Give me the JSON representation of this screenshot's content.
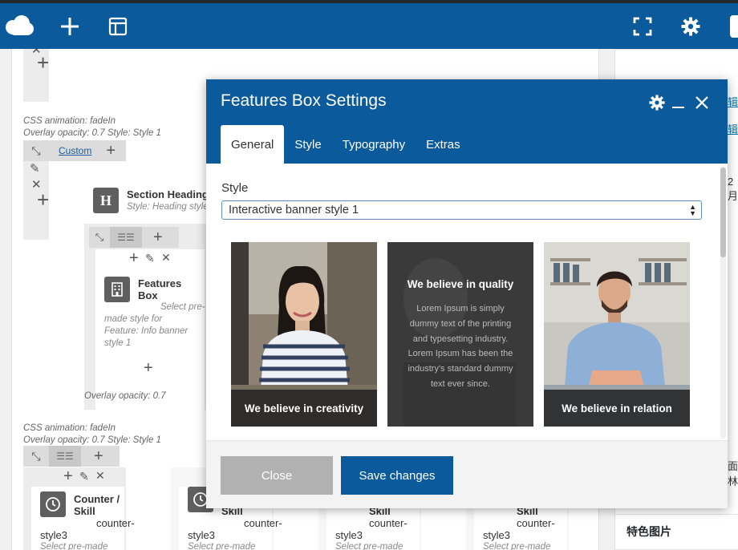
{
  "toolbar": {
    "icons": [
      "cloud-logo-icon",
      "plus-icon",
      "layout-icon",
      "fullscreen-icon",
      "gear-icon"
    ]
  },
  "builder": {
    "row1": {
      "meta_line1": "CSS animation: fadeIn",
      "meta_line2": "Overlay opacity: 0.7  Style: Style 1",
      "custom_link": "Custom"
    },
    "section_heading": {
      "title": "Section Heading",
      "subtitle": "Style: Heading style"
    },
    "features_box": {
      "title_line1": "Features",
      "title_line2": "Box",
      "desc": [
        "Select pre-",
        "made style for",
        "Feature: Info banner",
        "style 1"
      ]
    },
    "overlay_note": "Overlay opacity: 0.7",
    "row2": {
      "meta_line1": "CSS animation: fadeIn",
      "meta_line2": "Overlay opacity: 0.7  Style: Style 1"
    },
    "counters": [
      {
        "title1": "Counter /",
        "title2": "Skill",
        "sub": "counter-",
        "style": "style3",
        "desc": "Select pre-made"
      },
      {
        "title1": "",
        "title2": "Skill",
        "sub": "counter-",
        "style": "style3",
        "desc": "Select pre-made"
      },
      {
        "title1": "",
        "title2": "Skill",
        "sub": "counter-",
        "style": "style3",
        "desc": "Select pre-made"
      },
      {
        "title1": "",
        "title2": "Skill",
        "sub": "counter-",
        "style": "style3",
        "desc": "Select pre-made"
      }
    ]
  },
  "right_column": {
    "link1": "辑",
    "link2": "辑",
    "text1": "2月",
    "text2": "面林",
    "featured_image": "特色图片"
  },
  "modal": {
    "title": "Features Box Settings",
    "tabs": [
      {
        "label": "General",
        "active": true
      },
      {
        "label": "Style",
        "active": false
      },
      {
        "label": "Typography",
        "active": false
      },
      {
        "label": "Extras",
        "active": false
      }
    ],
    "style_label": "Style",
    "style_value": "Interactive banner style 1",
    "banners": [
      {
        "caption": "We believe in creativity"
      },
      {
        "title": "We believe in quality",
        "text": "Lorem Ipsum is simply dummy text of the printing and typesetting industry. Lorem Ipsum has been the industry's standard dummy text ever since."
      },
      {
        "caption": "We believe in relation"
      }
    ],
    "close_label": "Close",
    "save_label": "Save changes",
    "colors": {
      "header": "#0b5a9c",
      "save_button": "#0b5a9c",
      "close_button": "#b1b1b1"
    }
  }
}
